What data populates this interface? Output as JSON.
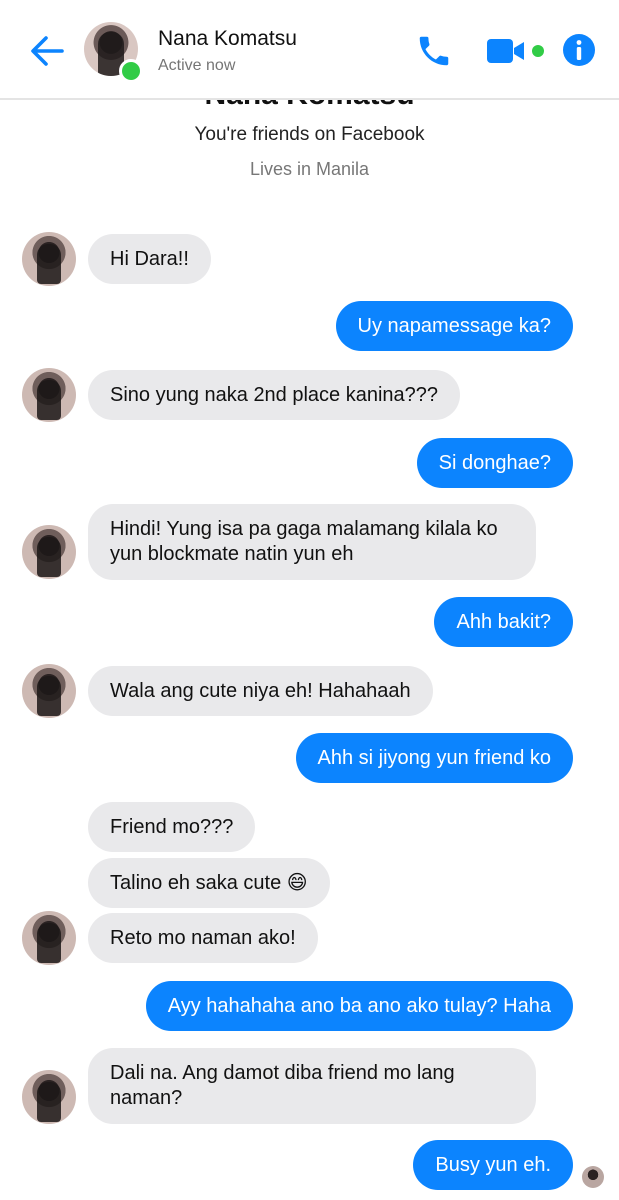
{
  "header": {
    "contact_name": "Nana Komatsu",
    "status": "Active now",
    "accent_color": "#0c84fe",
    "online_color": "#31cc46",
    "icons": [
      "back-arrow-icon",
      "phone-icon",
      "video-camera-icon",
      "info-icon"
    ]
  },
  "intro": {
    "name": "Nana Komatsu",
    "friends_text": "You're friends on Facebook",
    "lives_text": "Lives in Manila"
  },
  "messages": [
    {
      "from": "them",
      "text": "Hi Dara!!"
    },
    {
      "from": "me",
      "text": "Uy napamessage ka?"
    },
    {
      "from": "them",
      "text": "Sino yung naka 2nd place kanina???"
    },
    {
      "from": "me",
      "text": "Si donghae?"
    },
    {
      "from": "them",
      "text": "Hindi! Yung isa pa gaga malamang kilala ko yun blockmate natin yun eh"
    },
    {
      "from": "me",
      "text": "Ahh bakit?"
    },
    {
      "from": "them",
      "text": "Wala ang cute niya eh! Hahahaah"
    },
    {
      "from": "me",
      "text": "Ahh si jiyong yun friend ko"
    },
    {
      "from": "them",
      "text": "Friend mo???"
    },
    {
      "from": "them",
      "text": "Talino eh saka cute 😄"
    },
    {
      "from": "them",
      "text": "Reto mo naman ako!"
    },
    {
      "from": "me",
      "text": "Ayy hahahaha ano ba ano ako tulay? Haha"
    },
    {
      "from": "them",
      "text": "Dali na. Ang damot diba friend mo lang naman?"
    },
    {
      "from": "me",
      "text": "Busy yun eh."
    }
  ]
}
